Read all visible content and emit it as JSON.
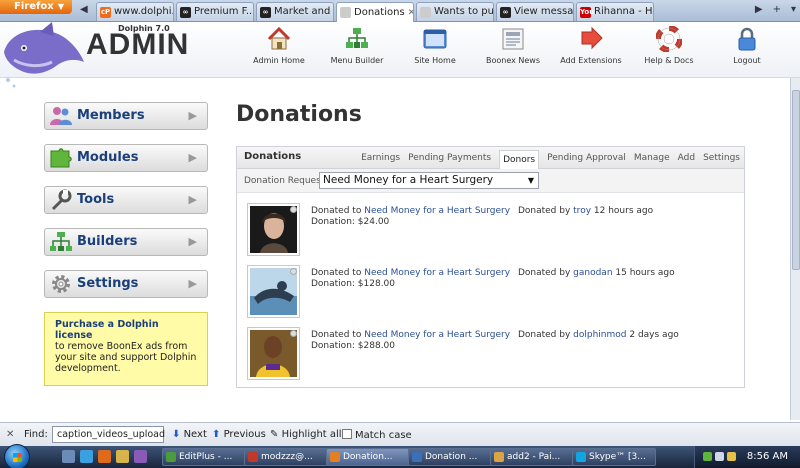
{
  "browser": {
    "menu_label": "Firefox",
    "tabs": [
      {
        "label": "www.dolphi...",
        "fav": "cP",
        "fav_color": "#f26b1d"
      },
      {
        "label": "Premium F...",
        "fav": "∞",
        "fav_color": "#222222"
      },
      {
        "label": "Market and ...",
        "fav": "∞",
        "fav_color": "#222222"
      },
      {
        "label": "Donations",
        "fav": "",
        "fav_color": "#cccccc"
      },
      {
        "label": "Wants to pu...",
        "fav": "",
        "fav_color": "#cccccc"
      },
      {
        "label": "View messa...",
        "fav": "∞",
        "fav_color": "#222222"
      },
      {
        "label": "Rihanna - H...",
        "fav": "You",
        "fav_color": "#cc0000"
      }
    ],
    "active_tab": 3
  },
  "header": {
    "product": "Dolphin 7.0",
    "logo": "ADMIN",
    "nav": [
      {
        "label": "Admin Home",
        "icon": "house-icon"
      },
      {
        "label": "Menu Builder",
        "icon": "menu-builder-icon"
      },
      {
        "label": "Site Home",
        "icon": "site-home-icon"
      },
      {
        "label": "Boonex News",
        "icon": "news-icon"
      },
      {
        "label": "Add Extensions",
        "icon": "add-extensions-icon"
      },
      {
        "label": "Help & Docs",
        "icon": "lifebuoy-icon"
      },
      {
        "label": "Logout",
        "icon": "lock-icon"
      }
    ]
  },
  "sidebar": {
    "items": [
      {
        "label": "Members",
        "icon": "members-icon"
      },
      {
        "label": "Modules",
        "icon": "modules-icon"
      },
      {
        "label": "Tools",
        "icon": "tools-icon"
      },
      {
        "label": "Builders",
        "icon": "builders-icon"
      },
      {
        "label": "Settings",
        "icon": "settings-icon"
      }
    ],
    "promo": {
      "title": "Purchase a Dolphin license",
      "text": "to remove BoonEx ads from your site and support Dolphin development."
    }
  },
  "main": {
    "title": "Donations",
    "panel": {
      "title": "Donations",
      "tabs": [
        "Earnings",
        "Pending Payments",
        "Donors",
        "Pending Approval",
        "Manage",
        "Add",
        "Settings"
      ],
      "active_tab": "Donors",
      "request_label": "Donation Requests",
      "request_selected": "Need Money for a Heart Surgery",
      "donations": [
        {
          "prefix": "Donated to",
          "request": "Need Money for a Heart Surgery",
          "by_label": "Donated by",
          "donor": "troy",
          "time": "12 hours ago",
          "amount": "Donation: $24.00"
        },
        {
          "prefix": "Donated to",
          "request": "Need Money for a Heart Surgery",
          "by_label": "Donated by",
          "donor": "ganodan",
          "time": "15 hours ago",
          "amount": "Donation: $128.00"
        },
        {
          "prefix": "Donated to",
          "request": "Need Money for a Heart Surgery",
          "by_label": "Donated by",
          "donor": "dolphinmod",
          "time": "2 days ago",
          "amount": "Donation: $288.00"
        }
      ]
    }
  },
  "findbar": {
    "label": "Find:",
    "query": "caption_videos_upload",
    "next": "Next",
    "previous": "Previous",
    "highlight": "Highlight all",
    "match_case": "Match case"
  },
  "taskbar": {
    "buttons": [
      {
        "label": "EditPlus - ...",
        "color": "#4a9d3a"
      },
      {
        "label": "modzzz@...",
        "color": "#c0392b"
      },
      {
        "label": "Donation...",
        "color": "#e67e22"
      },
      {
        "label": "Donation ...",
        "color": "#3b6fb6"
      },
      {
        "label": "add2 - Pai...",
        "color": "#d9a441"
      },
      {
        "label": "Skype™ [3...",
        "color": "#12a5e0"
      }
    ],
    "active_button": 2,
    "clock": "8:56 AM"
  }
}
